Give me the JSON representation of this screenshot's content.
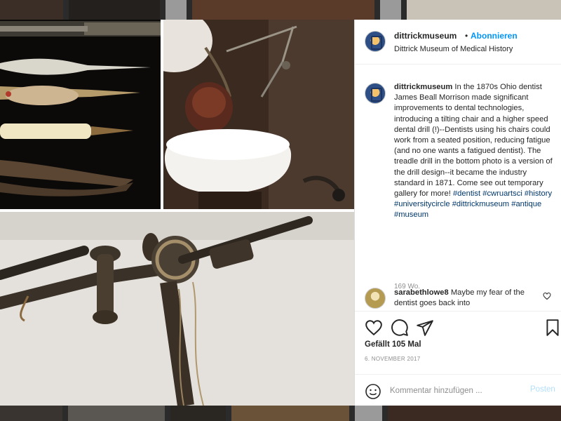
{
  "post": {
    "username": "dittrickmuseum",
    "follow_label": "Abonnieren",
    "dot": "•",
    "location": "Dittrick Museum of Medical History",
    "caption": "In the 1870s Ohio dentist James Beall Morrison made significant improvements to dental technologies, introducing a tilting chair and a higher speed dental drill (!)--Dentists using his chairs could work from a seated position, reducing fatigue (and no one wants a fatigued dentist). The treadle drill in the bottom photo is a version of the drill design--it became the industry standard in 1871. Come see out temporary gallery for more!",
    "hashtags": "#dentist #cwruartsci #history #universitycircle #dittrickmuseum #antique #museum",
    "time_ago": "169 Wo.",
    "likes": "Gefällt 105 Mal",
    "date": "6. NOVEMBER 2017"
  },
  "comment": {
    "username": "sarabethlowe8",
    "text": "Maybe my fear of the dentist goes back into"
  },
  "add_comment": {
    "placeholder": "Kommentar hinzufügen ...",
    "post_label": "Posten"
  },
  "colors": {
    "accent": "#0095f6",
    "text": "#262626",
    "muted": "#8e8e8e",
    "post_disabled": "#b2dffc",
    "hashtag": "#00376b"
  },
  "icons": {
    "like": "heart-icon",
    "comment": "comment-bubble-icon",
    "share": "paper-plane-icon",
    "save": "bookmark-icon",
    "emoji": "smiley-icon"
  }
}
